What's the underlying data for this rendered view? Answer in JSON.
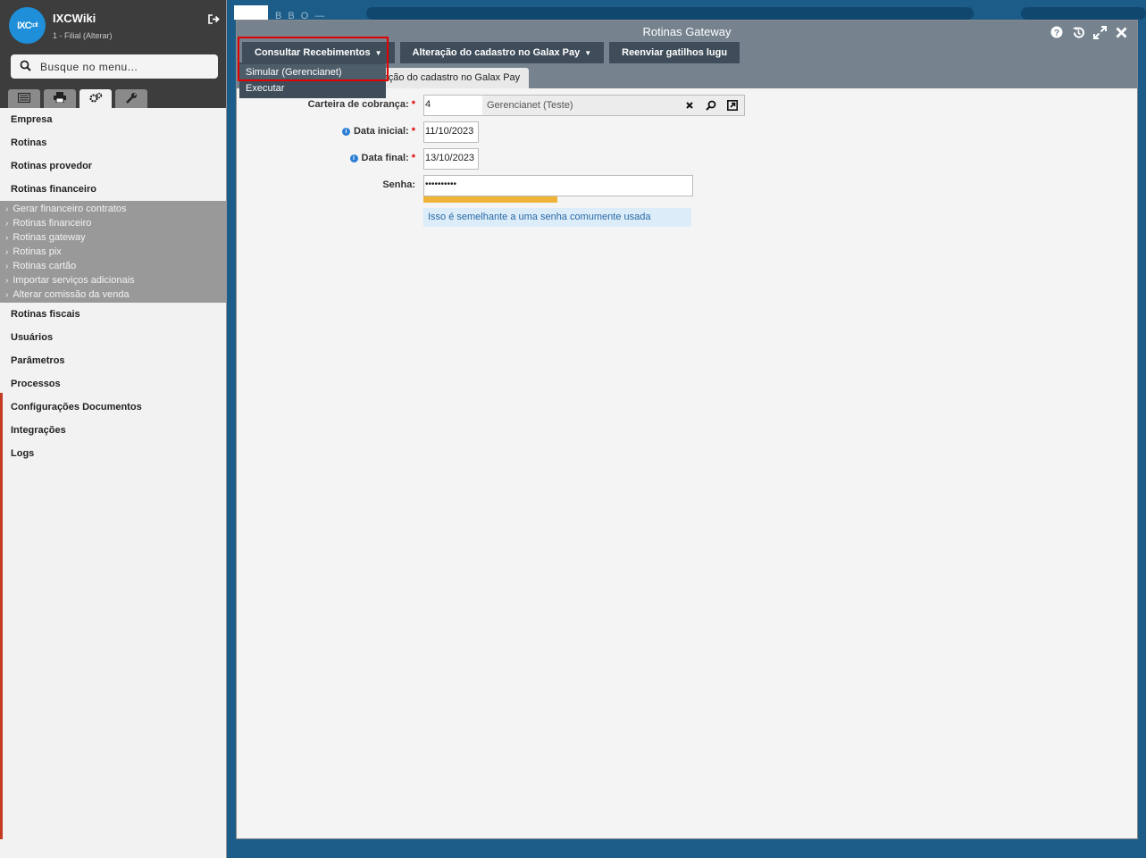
{
  "app": {
    "brand": "IXCWiki",
    "branch": "1 - Filial (Alterar)",
    "logo_text": "IXC",
    "logo_sub": "soft",
    "background_text": "B B O —"
  },
  "search": {
    "placeholder": "Busque no menu..."
  },
  "sidebar": {
    "tabs": [
      "list-icon",
      "printer-icon",
      "gears-icon",
      "wrench-icon"
    ],
    "categories": [
      {
        "label": "Empresa"
      },
      {
        "label": "Rotinas"
      },
      {
        "label": "Rotinas provedor"
      },
      {
        "label": "Rotinas financeiro"
      },
      {
        "label": "Rotinas fiscais"
      },
      {
        "label": "Usuários"
      },
      {
        "label": "Parâmetros"
      },
      {
        "label": "Processos"
      },
      {
        "label": "Configurações Documentos"
      },
      {
        "label": "Integrações"
      },
      {
        "label": "Logs"
      }
    ],
    "financeiro_items": [
      "Gerar financeiro contratos",
      "Rotinas financeiro",
      "Rotinas gateway",
      "Rotinas pix",
      "Rotinas cartão",
      "Importar serviços adicionais",
      "Alterar comissão da venda"
    ]
  },
  "window": {
    "title": "Rotinas Gateway",
    "toolbar": {
      "consultar": "Consultar Recebimentos",
      "alteracao": "Alteração do cadastro no Galax Pay",
      "reenviar": "Reenviar gatilhos lugu"
    },
    "dropdown": [
      "Simular (Gerencianet)",
      "Executar"
    ],
    "form_tab": "ração do cadastro no Galax Pay"
  },
  "form": {
    "carteira": {
      "label": "Carteira de cobrança:",
      "value": "4",
      "description": "Gerencianet (Teste)"
    },
    "data_inicial": {
      "label": "Data inicial:",
      "value": "11/10/2023"
    },
    "data_final": {
      "label": "Data final:",
      "value": "13/10/2023"
    },
    "senha": {
      "label": "Senha:",
      "value": "••••••••••"
    },
    "password_hint": "Isso é semelhante a uma senha comumente usada",
    "required_mark": "*",
    "strength_level": 0.5
  },
  "colors": {
    "sidebar_header": "#3d3d3d",
    "window_header": "#76838f",
    "button": "#3f4d5a",
    "accent_highlight": "#e00000",
    "strength_bar": "#f0b33a"
  }
}
